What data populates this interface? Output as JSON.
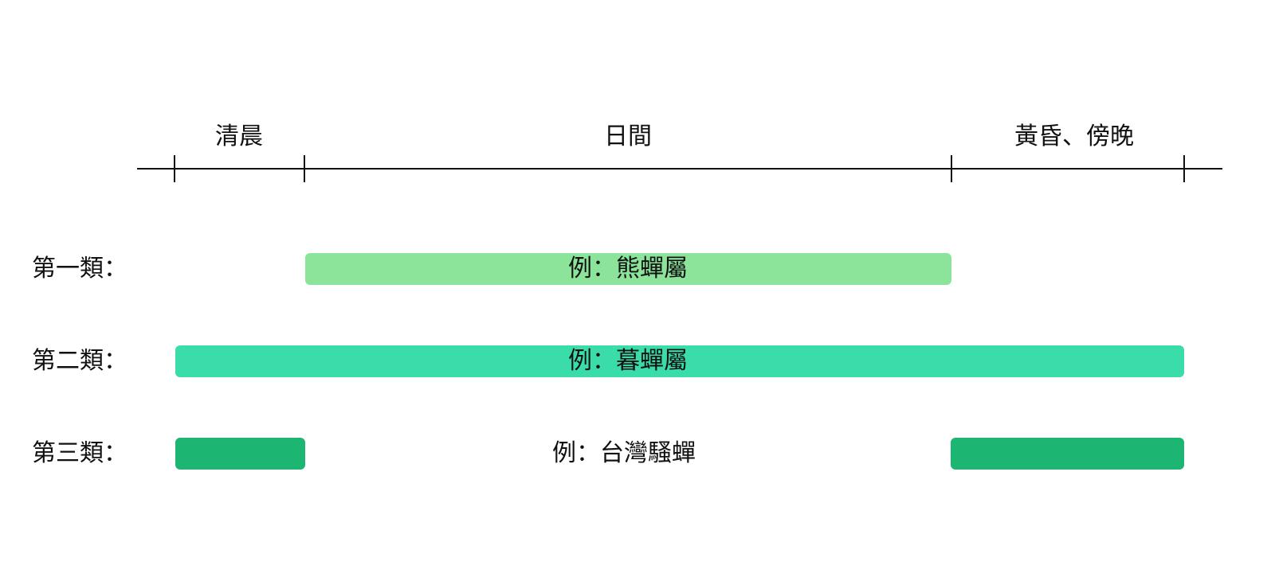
{
  "periods": [
    {
      "label": "清晨"
    },
    {
      "label": "日間"
    },
    {
      "label": "黃昏、傍晚"
    }
  ],
  "rows": [
    {
      "label": "第一類：",
      "example": "例：熊蟬屬",
      "color": "#8ce39a"
    },
    {
      "label": "第二類：",
      "example": "例：暮蟬屬",
      "color": "#3adcaa"
    },
    {
      "label": "第三類：",
      "example": "例：台灣騷蟬",
      "color": "#1cb572"
    }
  ]
}
